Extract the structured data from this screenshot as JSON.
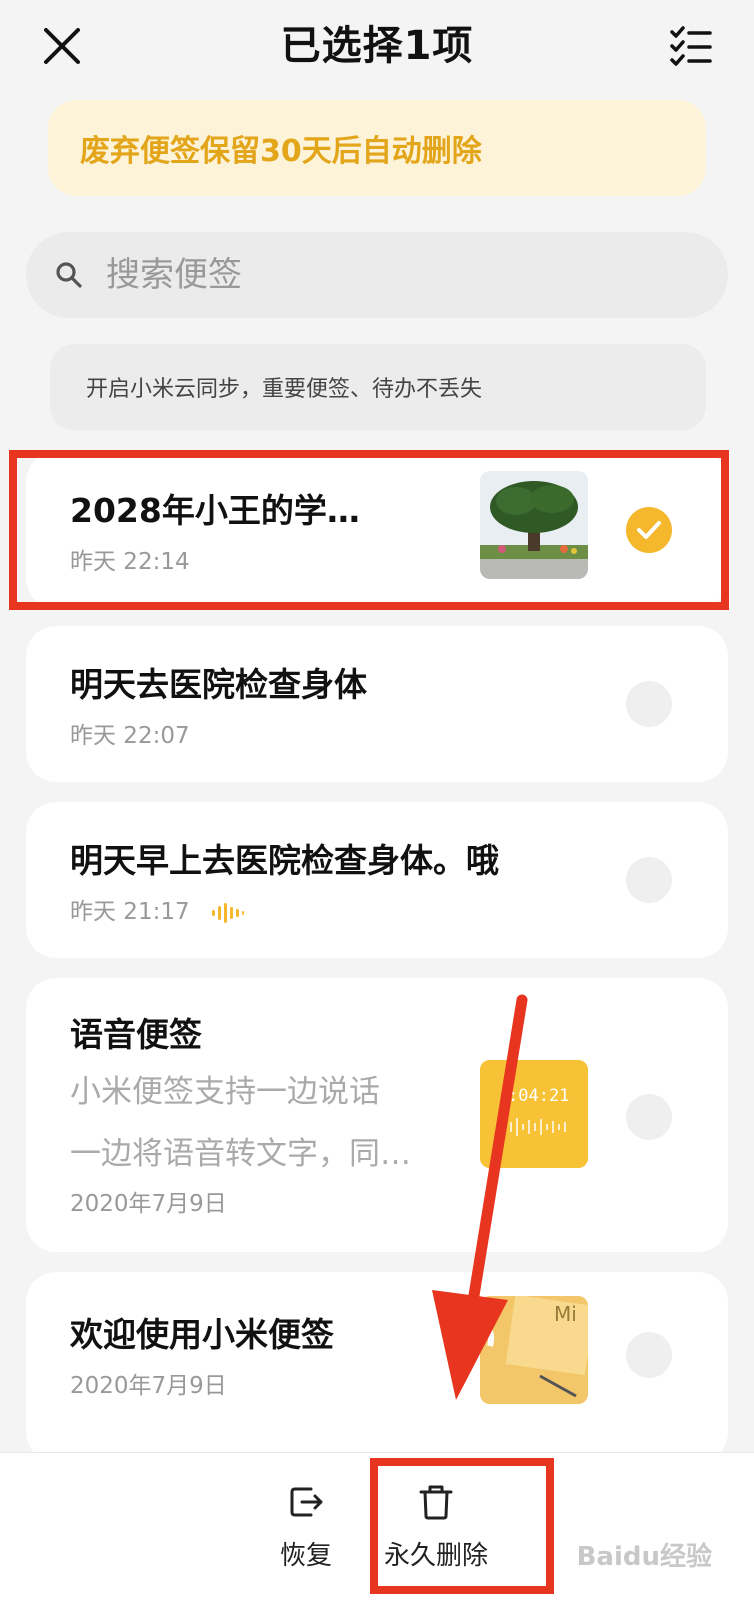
{
  "header": {
    "title": "已选择1项",
    "close_icon": "close-icon",
    "select_all_icon": "checklist-icon"
  },
  "notice": {
    "text": "废弃便签保留30天后自动删除"
  },
  "search": {
    "placeholder": "搜索便签"
  },
  "sync_tip": {
    "text": "开启小米云同步，重要便签、待办不丢失"
  },
  "notes": [
    {
      "title": "2028年小王的学…",
      "date": "昨天 22:14",
      "has_image": true,
      "thumbnail": "tree-photo",
      "selected": true
    },
    {
      "title": "明天去医院检查身体",
      "date": "昨天 22:07",
      "has_image": false,
      "selected": false
    },
    {
      "title": "明天早上去医院检查身体。哦",
      "date": "昨天 21:17",
      "has_audio": true,
      "selected": false
    },
    {
      "title": "语音便签",
      "body_line1": "小米便签支持一边说话",
      "body_line2": "一边将语音转文字，同…",
      "date": "2020年7月9日",
      "thumbnail": "voice-note-thumb",
      "thumbnail_text": ":04:21",
      "selected": false
    },
    {
      "title": "欢迎使用小米便签",
      "date": "2020年7月9日",
      "thumbnail": "sticky-note-thumb",
      "thumbnail_text": "Mi",
      "selected": false
    }
  ],
  "bottom_actions": {
    "restore_label": "恢复",
    "delete_label": "永久删除"
  },
  "watermark": {
    "text": "Baidu经验"
  },
  "colors": {
    "accent": "#f5b72b",
    "notice_text": "#e3a51a",
    "annotation_red": "#e8351f"
  }
}
